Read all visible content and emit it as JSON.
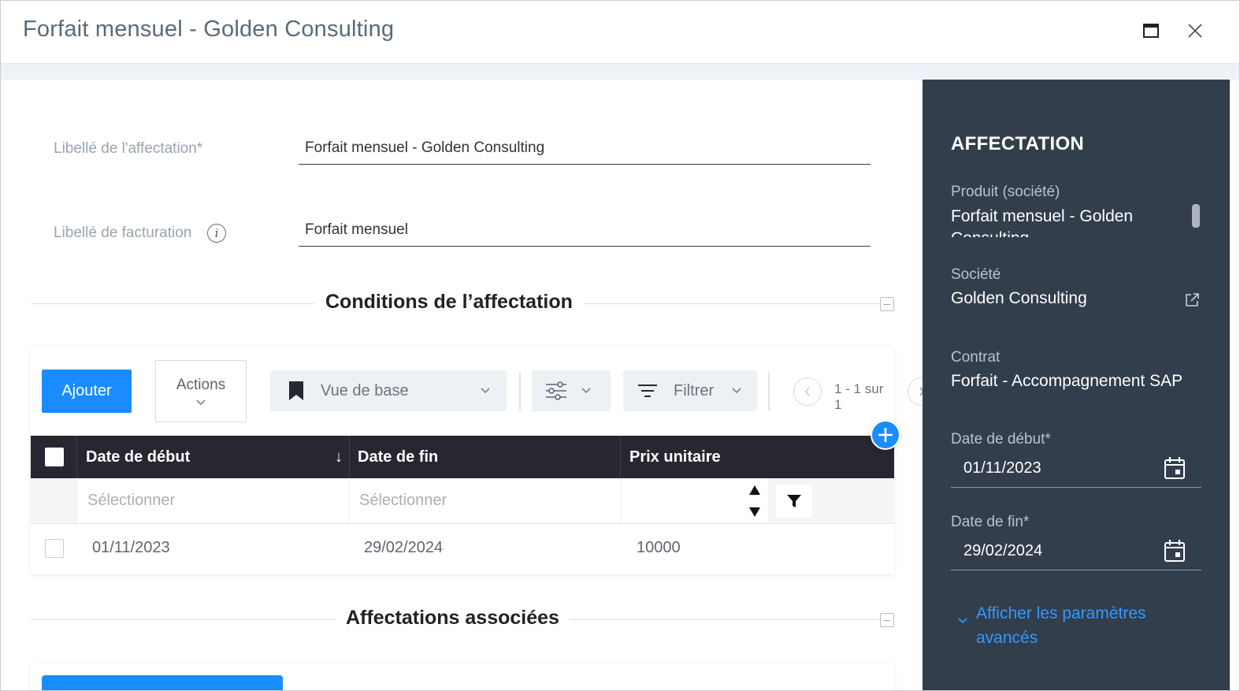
{
  "window": {
    "title": "Forfait mensuel - Golden Consulting"
  },
  "form": {
    "assignment_label": "Libellé de l'affectation*",
    "assignment_value": "Forfait mensuel - Golden Consulting",
    "billing_label": "Libellé de facturation",
    "billing_value": "Forfait mensuel",
    "info_glyph": "i"
  },
  "sections": {
    "conditions_title": "Conditions de l’affectation",
    "associated_title": "Affectations associées"
  },
  "toolbar": {
    "add_label": "Ajouter",
    "actions_label": "Actions",
    "view_label": "Vue de base",
    "filter_label": "Filtrer",
    "pagination": "1 - 1 sur 1"
  },
  "table": {
    "columns": [
      "Date de début",
      "Date de fin",
      "Prix unitaire"
    ],
    "sort_glyph": "↓",
    "filter_placeholder": "Sélectionner",
    "rows": [
      {
        "start": "01/11/2023",
        "end": "29/02/2024",
        "price": "10000"
      }
    ]
  },
  "sidebar": {
    "heading": "AFFECTATION",
    "product_label": "Produit (société)",
    "product_value": "Forfait mensuel - Golden Consulting",
    "company_label": "Société",
    "company_value": "Golden Consulting",
    "contract_label": "Contrat",
    "contract_value": "Forfait - Accompagnement SAP",
    "start_label": "Date de début*",
    "start_value": "01/11/2023",
    "end_label": "Date de fin*",
    "end_value": "29/02/2024",
    "advanced_link": "Afficher les paramètres avancés"
  },
  "colors": {
    "primary": "#1a8cff",
    "sidebar_bg": "#333e4d",
    "table_header_bg": "#262730",
    "link": "#2e9bff"
  },
  "icons": [
    "maximize-icon",
    "close-icon",
    "info-icon",
    "bookmark-icon",
    "sliders-icon",
    "filter-lines-icon",
    "chevron-down-icon",
    "chevron-left-icon",
    "chevron-right-icon",
    "plus-icon",
    "funnel-icon",
    "sort-stepper-icon",
    "calendar-icon",
    "external-link-icon"
  ]
}
